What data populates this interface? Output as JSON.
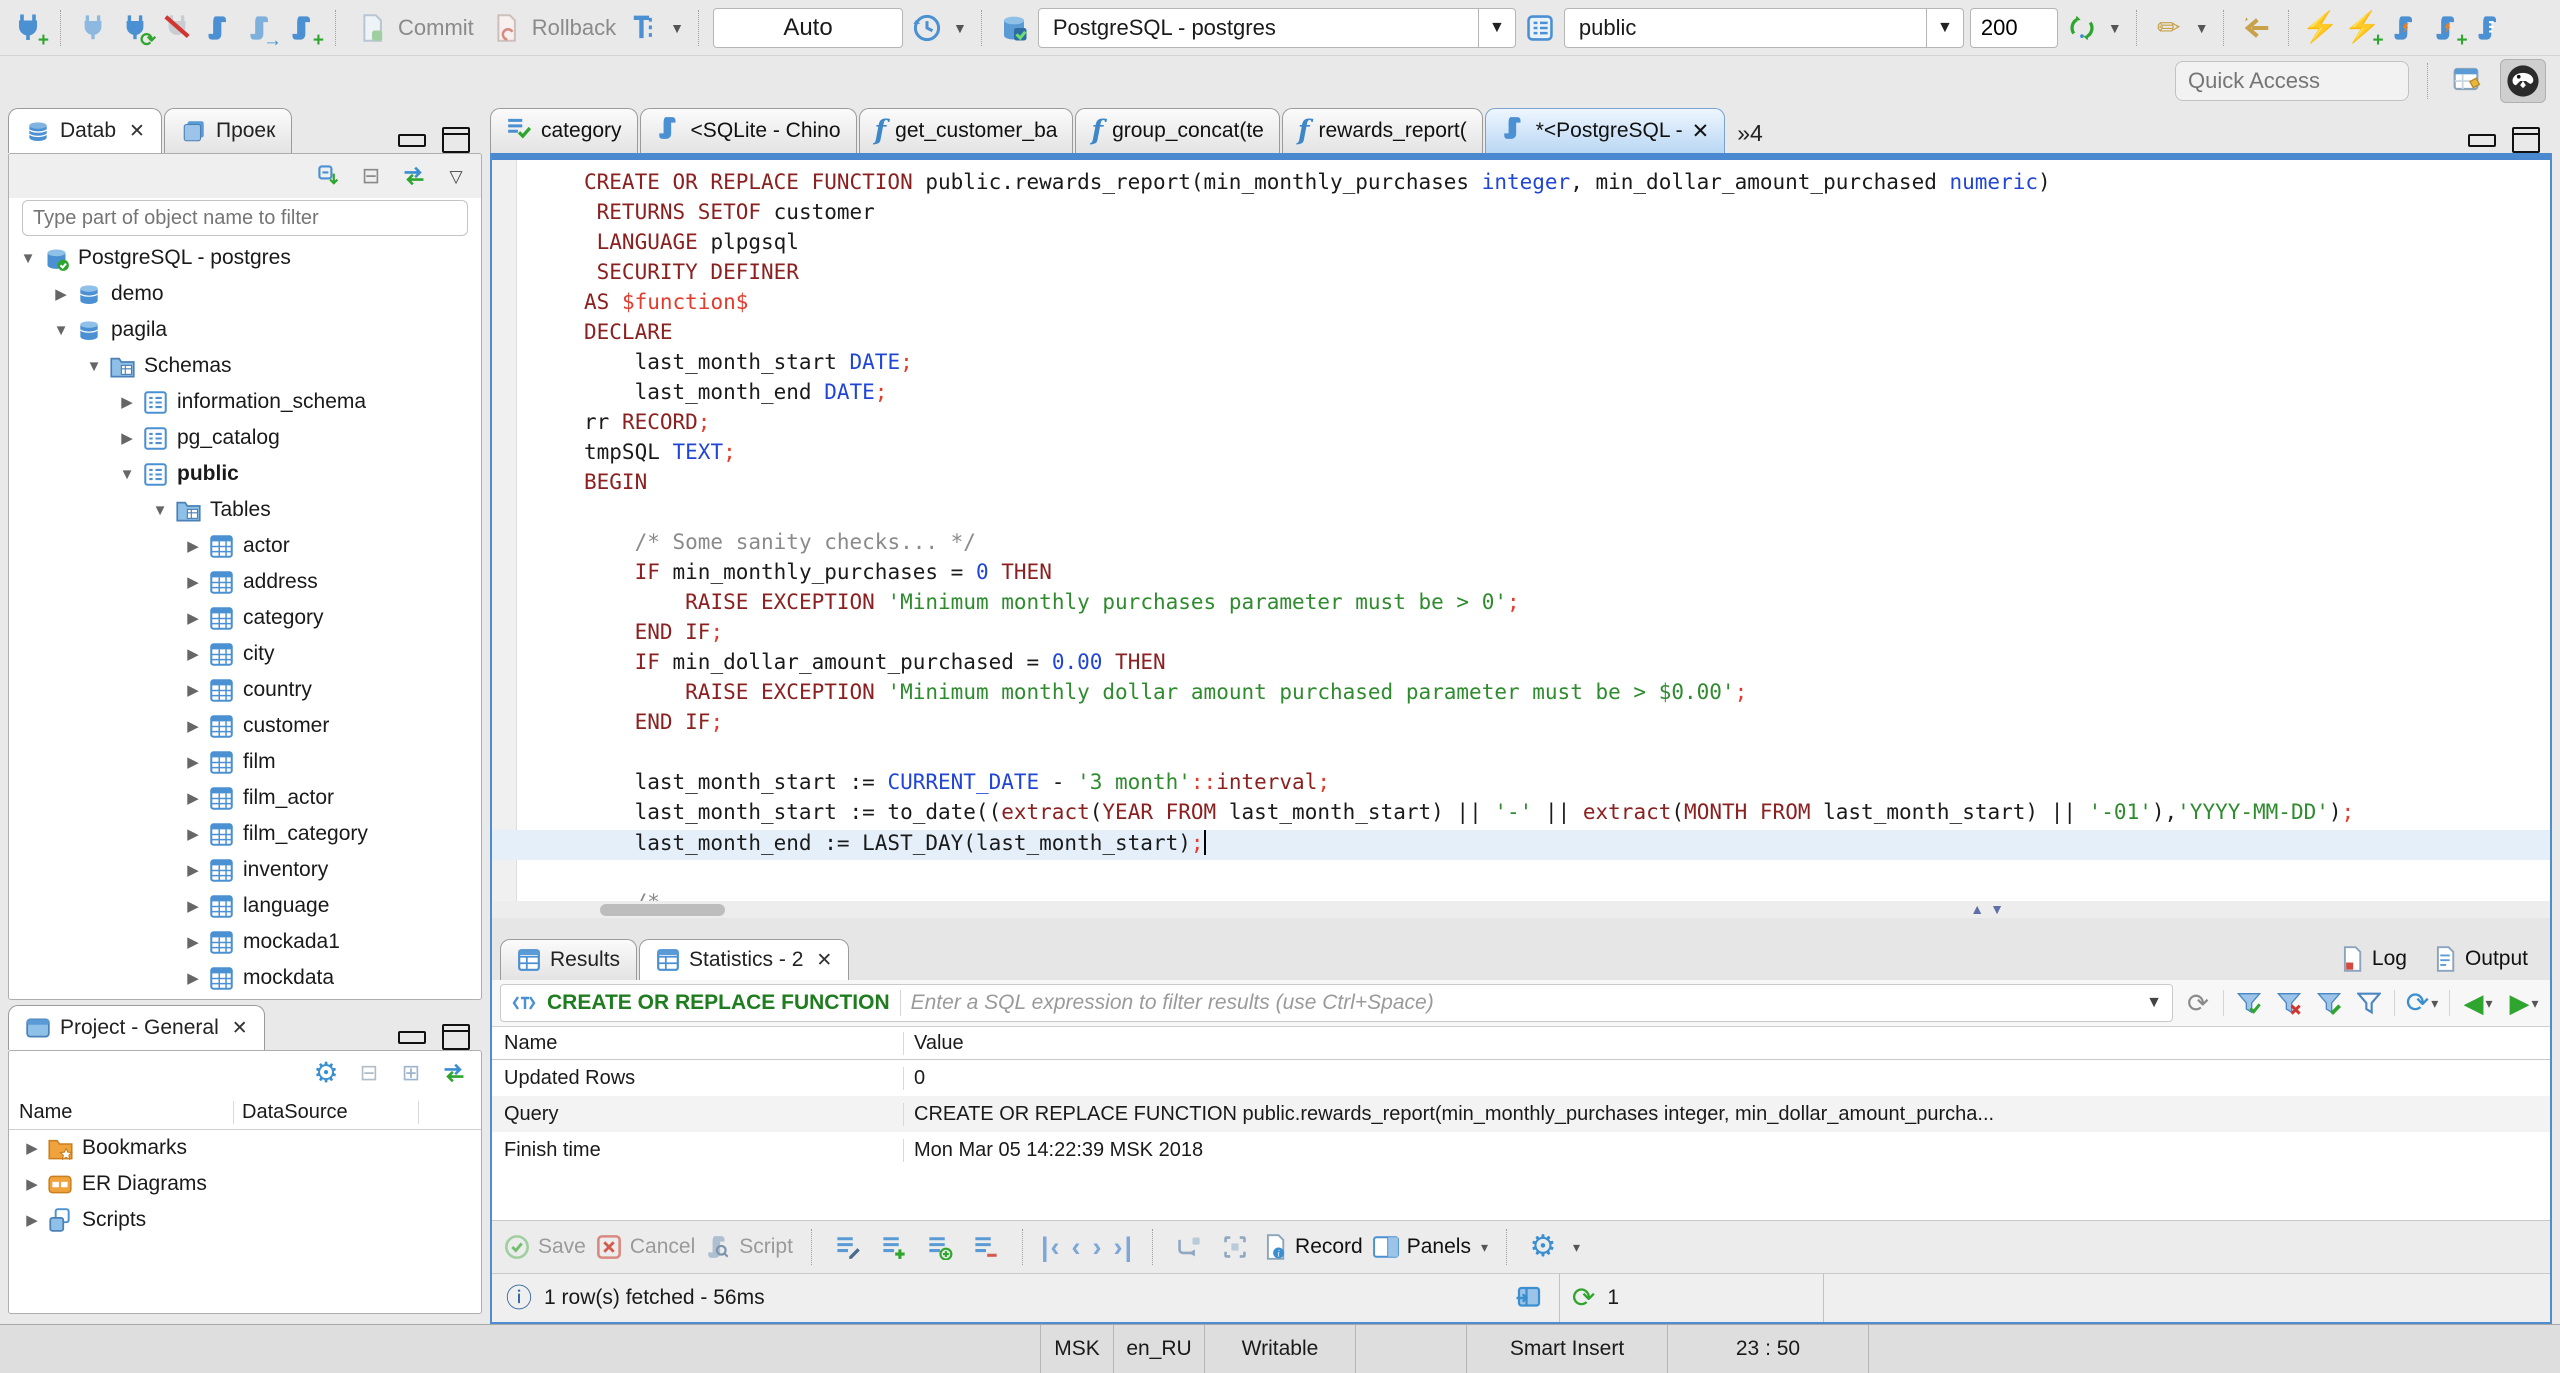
{
  "toolbar": {
    "auto_commit": "Auto",
    "commit": "Commit",
    "rollback": "Rollback",
    "connection": "PostgreSQL - postgres",
    "schema": "public",
    "fetch_size": "200",
    "quick_access_placeholder": "Quick Access"
  },
  "navigator": {
    "tab_database": "Datab",
    "tab_project": "Проек",
    "filter_placeholder": "Type part of object name to filter",
    "tree": [
      {
        "label": "PostgreSQL - postgres",
        "level": 0,
        "state": "open",
        "icon": "db-conn"
      },
      {
        "label": "demo",
        "level": 1,
        "state": "closed",
        "icon": "db"
      },
      {
        "label": "pagila",
        "level": 1,
        "state": "open",
        "icon": "db"
      },
      {
        "label": "Schemas",
        "level": 2,
        "state": "open",
        "icon": "folder"
      },
      {
        "label": "information_schema",
        "level": 3,
        "state": "closed",
        "icon": "schema"
      },
      {
        "label": "pg_catalog",
        "level": 3,
        "state": "closed",
        "icon": "schema"
      },
      {
        "label": "public",
        "level": 3,
        "state": "open",
        "icon": "schema",
        "bold": true
      },
      {
        "label": "Tables",
        "level": 4,
        "state": "open",
        "icon": "folder"
      },
      {
        "label": "actor",
        "level": 5,
        "state": "closed",
        "icon": "table"
      },
      {
        "label": "address",
        "level": 5,
        "state": "closed",
        "icon": "table"
      },
      {
        "label": "category",
        "level": 5,
        "state": "closed",
        "icon": "table"
      },
      {
        "label": "city",
        "level": 5,
        "state": "closed",
        "icon": "table"
      },
      {
        "label": "country",
        "level": 5,
        "state": "closed",
        "icon": "table"
      },
      {
        "label": "customer",
        "level": 5,
        "state": "closed",
        "icon": "table"
      },
      {
        "label": "film",
        "level": 5,
        "state": "closed",
        "icon": "table"
      },
      {
        "label": "film_actor",
        "level": 5,
        "state": "closed",
        "icon": "table"
      },
      {
        "label": "film_category",
        "level": 5,
        "state": "closed",
        "icon": "table"
      },
      {
        "label": "inventory",
        "level": 5,
        "state": "closed",
        "icon": "table"
      },
      {
        "label": "language",
        "level": 5,
        "state": "closed",
        "icon": "table"
      },
      {
        "label": "mockada1",
        "level": 5,
        "state": "closed",
        "icon": "table"
      },
      {
        "label": "mockdata",
        "level": 5,
        "state": "closed",
        "icon": "table"
      }
    ]
  },
  "project": {
    "tab": "Project - General",
    "col_name": "Name",
    "col_datasource": "DataSource",
    "items": [
      {
        "label": "Bookmarks",
        "icon": "bookmarks"
      },
      {
        "label": "ER Diagrams",
        "icon": "er"
      },
      {
        "label": "Scripts",
        "icon": "scripts"
      }
    ]
  },
  "editor": {
    "tabs": [
      {
        "label": "category",
        "icon": "data",
        "active": false
      },
      {
        "label": "<SQLite - Chino",
        "icon": "sql",
        "active": false
      },
      {
        "label": "get_customer_ba",
        "icon": "fn",
        "active": false
      },
      {
        "label": "group_concat(te",
        "icon": "fn",
        "active": false
      },
      {
        "label": "rewards_report(",
        "icon": "fn",
        "active": false
      },
      {
        "label": "*<PostgreSQL - ",
        "icon": "sql",
        "active": true
      }
    ],
    "overflow": "»4",
    "current_line": 22,
    "code": [
      [
        [
          "CREATE OR REPLACE FUNCTION",
          "k"
        ],
        [
          " public.rewards_report(min_monthly_purchases ",
          "p"
        ],
        [
          "integer",
          "t"
        ],
        [
          ", min_dollar_amount_purchased ",
          "p"
        ],
        [
          "numeric",
          "t"
        ],
        [
          ")",
          "p"
        ]
      ],
      [
        [
          " RETURNS SETOF",
          "k"
        ],
        [
          " customer",
          "p"
        ]
      ],
      [
        [
          " LANGUAGE",
          "k"
        ],
        [
          " plpgsql",
          "p"
        ]
      ],
      [
        [
          " SECURITY DEFINER",
          "k"
        ]
      ],
      [
        [
          "AS ",
          "k"
        ],
        [
          "$function$",
          "r"
        ]
      ],
      [
        [
          "DECLARE",
          "k"
        ]
      ],
      [
        [
          "    last_month_start ",
          "p"
        ],
        [
          "DATE",
          "t"
        ],
        [
          ";",
          "r"
        ]
      ],
      [
        [
          "    last_month_end ",
          "p"
        ],
        [
          "DATE",
          "t"
        ],
        [
          ";",
          "r"
        ]
      ],
      [
        [
          "rr ",
          "p"
        ],
        [
          "RECORD",
          "k"
        ],
        [
          ";",
          "r"
        ]
      ],
      [
        [
          "tmpSQL ",
          "p"
        ],
        [
          "TEXT",
          "t"
        ],
        [
          ";",
          "r"
        ]
      ],
      [
        [
          "BEGIN",
          "k"
        ]
      ],
      [],
      [
        [
          "    ",
          "p"
        ],
        [
          "/* Some sanity checks... */",
          "c"
        ]
      ],
      [
        [
          "    ",
          "p"
        ],
        [
          "IF",
          "k"
        ],
        [
          " min_monthly_purchases = ",
          "p"
        ],
        [
          "0",
          "t"
        ],
        [
          " ",
          "p"
        ],
        [
          "THEN",
          "k"
        ]
      ],
      [
        [
          "        ",
          "p"
        ],
        [
          "RAISE EXCEPTION",
          "k"
        ],
        [
          " ",
          "p"
        ],
        [
          "'Minimum monthly purchases parameter must be > 0'",
          "s"
        ],
        [
          ";",
          "r"
        ]
      ],
      [
        [
          "    ",
          "p"
        ],
        [
          "END IF",
          "k"
        ],
        [
          ";",
          "r"
        ]
      ],
      [
        [
          "    ",
          "p"
        ],
        [
          "IF",
          "k"
        ],
        [
          " min_dollar_amount_purchased = ",
          "p"
        ],
        [
          "0.00",
          "t"
        ],
        [
          " ",
          "p"
        ],
        [
          "THEN",
          "k"
        ]
      ],
      [
        [
          "        ",
          "p"
        ],
        [
          "RAISE EXCEPTION",
          "k"
        ],
        [
          " ",
          "p"
        ],
        [
          "'Minimum monthly dollar amount purchased parameter must be > $0.00'",
          "s"
        ],
        [
          ";",
          "r"
        ]
      ],
      [
        [
          "    ",
          "p"
        ],
        [
          "END IF",
          "k"
        ],
        [
          ";",
          "r"
        ]
      ],
      [],
      [
        [
          "    last_month_start := ",
          "p"
        ],
        [
          "CURRENT_DATE",
          "t"
        ],
        [
          " - ",
          "p"
        ],
        [
          "'3 month'",
          "s"
        ],
        [
          "::",
          "r"
        ],
        [
          "interval",
          "k"
        ],
        [
          ";",
          "r"
        ]
      ],
      [
        [
          "    last_month_start := to_date((",
          "p"
        ],
        [
          "extract",
          "k"
        ],
        [
          "(",
          "p"
        ],
        [
          "YEAR FROM",
          "k"
        ],
        [
          " last_month_start) || ",
          "p"
        ],
        [
          "'-'",
          "s"
        ],
        [
          " || ",
          "p"
        ],
        [
          "extract",
          "k"
        ],
        [
          "(",
          "p"
        ],
        [
          "MONTH FROM",
          "k"
        ],
        [
          " last_month_start) || ",
          "p"
        ],
        [
          "'-01'",
          "s"
        ],
        [
          "),",
          "p"
        ],
        [
          "'YYYY-MM-DD'",
          "s"
        ],
        [
          ")",
          "p"
        ],
        [
          ";",
          "r"
        ]
      ],
      [
        [
          "    last_month_end := LAST_DAY(last_month_start)",
          "p"
        ],
        [
          ";",
          "r"
        ]
      ],
      [],
      [
        [
          "    ",
          "p"
        ],
        [
          "/*",
          "c"
        ]
      ]
    ]
  },
  "results": {
    "tab_results": "Results",
    "tab_statistics": "Statistics - 2",
    "log": "Log",
    "output": "Output",
    "filter_prefix": "CREATE OR REPLACE FUNCTION",
    "filter_placeholder": "Enter a SQL expression to filter results (use Ctrl+Space)",
    "columns": [
      "Name",
      "Value"
    ],
    "rows": [
      [
        "Updated Rows",
        "0"
      ],
      [
        "Query",
        "CREATE OR REPLACE FUNCTION public.rewards_report(min_monthly_purchases integer, min_dollar_amount_purcha..."
      ],
      [
        "Finish time",
        "Mon Mar 05 14:22:39 MSK 2018"
      ]
    ],
    "toolbar": {
      "save": "Save",
      "cancel": "Cancel",
      "script": "Script",
      "record": "Record",
      "panels": "Panels"
    },
    "status": "1 row(s) fetched - 56ms",
    "refresh_count": "1"
  },
  "statusbar": {
    "cells": [
      "MSK",
      "en_RU",
      "Writable",
      "Smart Insert",
      "23 : 50"
    ]
  },
  "colors": {
    "accent": "#4a88cf",
    "keyword": "#8b2020",
    "string": "#2e8b2e",
    "number": "#2145d4",
    "comment": "#8a8a8a",
    "delimiter": "#e23c2e",
    "disabled": "#9a9a9a"
  }
}
